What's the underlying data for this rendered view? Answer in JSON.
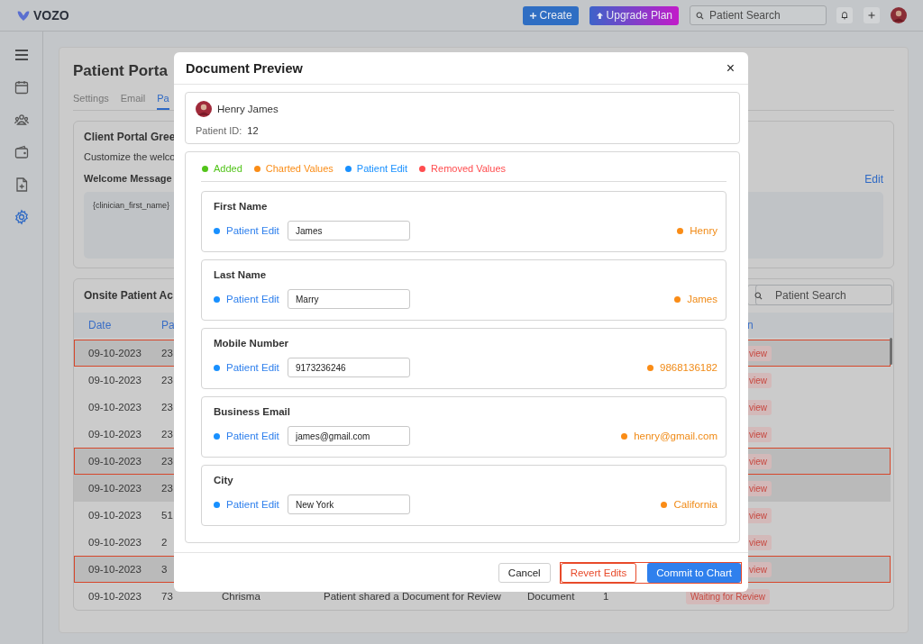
{
  "topbar": {
    "logo": "VOZO",
    "buttons": [
      {
        "label": "Create",
        "kind": "create"
      },
      {
        "label": "Upgrade Plan",
        "kind": "upgrade"
      }
    ],
    "search": {
      "placeholder": "Patient Search"
    },
    "actions": [
      {
        "kind": "bell"
      },
      {
        "kind": "plus"
      }
    ]
  },
  "sidebar": {
    "items": [
      {
        "kind": "menu",
        "selected": false
      },
      {
        "kind": "calendar",
        "selected": false
      },
      {
        "kind": "users",
        "selected": false
      },
      {
        "kind": "wallet",
        "selected": false
      },
      {
        "kind": "file",
        "selected": false
      },
      {
        "kind": "gear",
        "selected": true
      }
    ]
  },
  "page": {
    "title": "Patient Porta",
    "tabs": [
      {
        "label": "Settings",
        "selected": false
      },
      {
        "label": "Email",
        "selected": false
      },
      {
        "label": "Pa",
        "selected": true
      }
    ],
    "greeting": {
      "title": "Client Portal Gree",
      "description": "Customize the welco",
      "label": "Welcome Message",
      "message": "{clinician_first_name}",
      "edit": "Edit"
    },
    "activity": {
      "title": "Onsite Patient Ac",
      "search": {
        "placeholder": "Patient Search"
      },
      "columns": [
        "Date",
        "Pa",
        "n"
      ],
      "rows": [
        {
          "cells": [
            "09-10-2023",
            "23"
          ],
          "status": "view",
          "selected": true,
          "shaded": true
        },
        {
          "cells": [
            "09-10-2023",
            "23"
          ],
          "status": "view",
          "selected": false,
          "shaded": false
        },
        {
          "cells": [
            "09-10-2023",
            "23"
          ],
          "status": "view",
          "selected": false,
          "shaded": false
        },
        {
          "cells": [
            "09-10-2023",
            "23"
          ],
          "status": "view",
          "selected": false,
          "shaded": false
        },
        {
          "cells": [
            "09-10-2023",
            "23"
          ],
          "status": "view",
          "selected": true,
          "shaded": true
        },
        {
          "cells": [
            "09-10-2023",
            "23"
          ],
          "status": "view",
          "selected": false,
          "shaded": true
        },
        {
          "cells": [
            "09-10-2023",
            "51"
          ],
          "status": "view",
          "selected": false,
          "shaded": false
        },
        {
          "cells": [
            "09-10-2023",
            "2"
          ],
          "status": "view",
          "selected": false,
          "shaded": false
        },
        {
          "cells": [
            "09-10-2023",
            "3"
          ],
          "status": "view",
          "selected": true,
          "shaded": true
        },
        {
          "cells": [
            "09-10-2023",
            "73",
            "Chrisma",
            "Patient shared a Document for Review",
            "Document",
            "1"
          ],
          "status": "Waiting for Review",
          "selected": false,
          "shaded": false
        }
      ]
    }
  },
  "modal": {
    "title": "Document Preview",
    "close": "×",
    "patient": {
      "name": "Henry James",
      "id_label": "Patient ID:",
      "id": "12"
    },
    "legend": [
      {
        "label": "Added",
        "color": "#52c41a"
      },
      {
        "label": "Charted Values",
        "color": "#fa8c16"
      },
      {
        "label": "Patient Edit",
        "color": "#1890ff"
      },
      {
        "label": "Removed Values",
        "color": "#ff4d4f"
      }
    ],
    "fields": [
      {
        "label": "First Name",
        "source": "Patient Edit",
        "value": "James",
        "charted": "Henry"
      },
      {
        "label": "Last Name",
        "source": "Patient Edit",
        "value": "Marry",
        "charted": "James"
      },
      {
        "label": "Mobile Number",
        "source": "Patient Edit",
        "value": "9173236246",
        "charted": "9868136182"
      },
      {
        "label": "Business Email",
        "source": "Patient Edit",
        "value": "james@gmail.com",
        "charted": "henry@gmail.com"
      },
      {
        "label": "City",
        "source": "Patient Edit",
        "value": "New York",
        "charted": "California"
      }
    ],
    "buttons": [
      {
        "label": "Cancel",
        "kind": "cancel"
      },
      {
        "label": "Revert Edits",
        "kind": "revert"
      },
      {
        "label": "Commit to Chart",
        "kind": "commit"
      }
    ]
  }
}
